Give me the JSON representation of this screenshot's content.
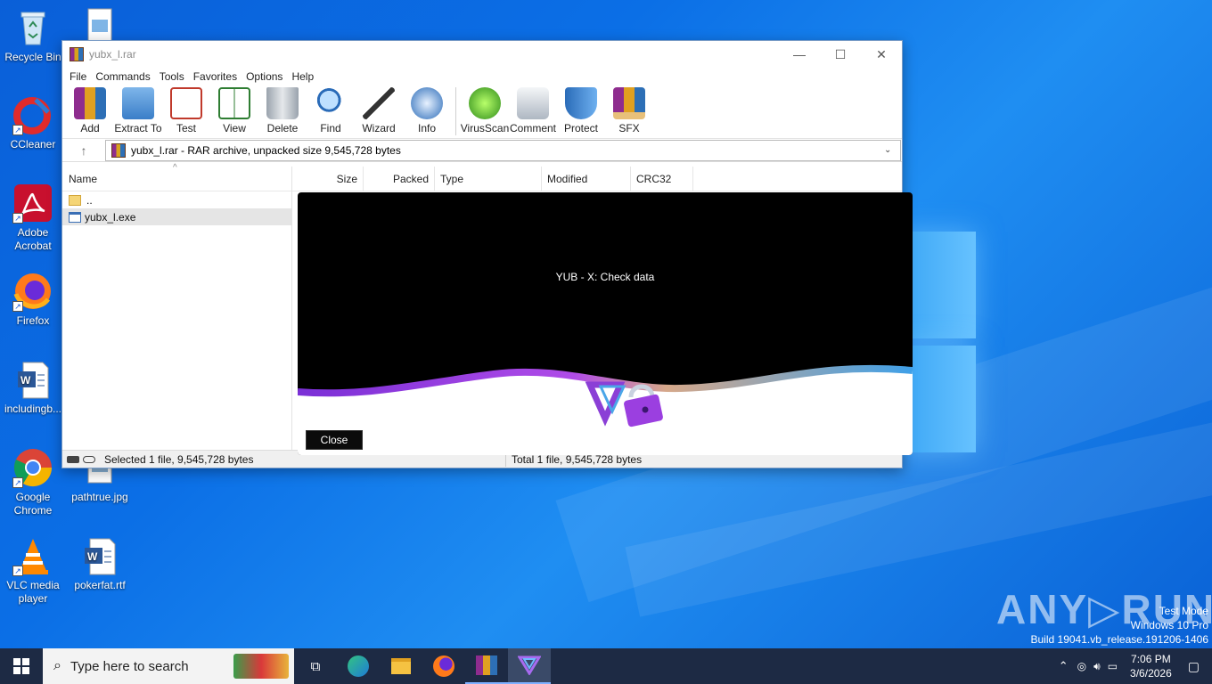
{
  "desktop": {
    "icons": [
      {
        "label": "Recycle Bin",
        "icon": "recycle-bin-icon"
      },
      {
        "label": "CCleaner",
        "icon": "ccleaner-icon"
      },
      {
        "label": "Adobe Acrobat",
        "icon": "acrobat-icon"
      },
      {
        "label": "Firefox",
        "icon": "firefox-icon"
      },
      {
        "label": "includingb...",
        "icon": "word-doc-icon"
      },
      {
        "label": "Google Chrome",
        "icon": "chrome-icon"
      },
      {
        "label": "VLC media player",
        "icon": "vlc-icon"
      },
      {
        "label": "pathtrue.jpg",
        "icon": "image-file-icon"
      },
      {
        "label": "pokerfat.rtf",
        "icon": "word-doc-icon"
      }
    ],
    "watermark": {
      "brand": "ANY RUN",
      "line1": "Test Mode",
      "line2": "Windows 10 Pro",
      "line3": "Build 19041.vb_release.191206-1406"
    }
  },
  "window": {
    "title": "yubx_l.rar",
    "controls": {
      "minimize": "—",
      "maximize": "☐",
      "close": "✕"
    },
    "menu": [
      "File",
      "Commands",
      "Tools",
      "Favorites",
      "Options",
      "Help"
    ],
    "toolbar": [
      "Add",
      "Extract To",
      "Test",
      "View",
      "Delete",
      "Find",
      "Wizard",
      "Info",
      "VirusScan",
      "Comment",
      "Protect",
      "SFX"
    ],
    "address": "yubx_l.rar - RAR archive, unpacked size 9,545,728 bytes",
    "columns": {
      "name": "Name",
      "size": "Size",
      "packed": "Packed",
      "type": "Type",
      "modified": "Modified",
      "crc": "CRC32"
    },
    "rows": [
      {
        "name": ".."
      },
      {
        "name": "yubx_l.exe"
      }
    ],
    "status_left": "Selected 1 file, 9,545,728 bytes",
    "status_right": "Total 1 file, 9,545,728 bytes"
  },
  "splash": {
    "title": "YUB - X: Check data",
    "close_label": "Close"
  },
  "taskbar": {
    "search_placeholder": "Type here to search",
    "time": "7:06 PM",
    "date": "3/6/2026"
  },
  "colors": {
    "desktop_blue": "#0b6fe6",
    "taskbar": "#1d2a44",
    "splash_purple": "#9b3fe0",
    "splash_blue": "#3fa0e8"
  }
}
